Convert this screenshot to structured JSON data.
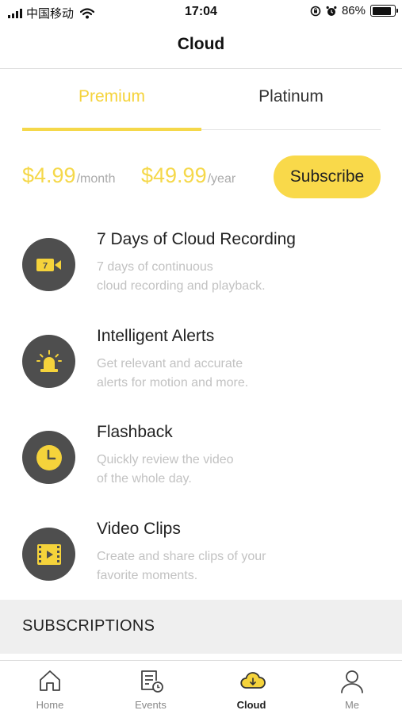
{
  "status_bar": {
    "carrier": "中国移动",
    "time": "17:04",
    "battery": "86%",
    "battery_level": 0.86,
    "icons": [
      "signal-icon",
      "wifi-icon",
      "rotation-lock-icon",
      "alarm-icon",
      "battery-icon"
    ]
  },
  "header": {
    "title": "Cloud"
  },
  "tabs": [
    {
      "label": "Premium",
      "selected": true
    },
    {
      "label": "Platinum",
      "selected": false
    }
  ],
  "pricing": {
    "monthly_amount": "$4.99",
    "monthly_unit": "/month",
    "yearly_amount": "$49.99",
    "yearly_unit": "/year",
    "subscribe_label": "Subscribe"
  },
  "features": [
    {
      "icon": "video-camera-7-icon",
      "title": "7 Days of Cloud Recording",
      "desc_line1": "7 days of continuous",
      "desc_line2": "cloud recording and playback."
    },
    {
      "icon": "alarm-light-icon",
      "title": "Intelligent Alerts",
      "desc_line1": "Get relevant and accurate",
      "desc_line2": "alerts for motion and more."
    },
    {
      "icon": "clock-icon",
      "title": "Flashback",
      "desc_line1": "Quickly review the video",
      "desc_line2": "of the whole day."
    },
    {
      "icon": "film-clip-icon",
      "title": "Video Clips",
      "desc_line1": "Create and share clips of your",
      "desc_line2": "favorite moments."
    }
  ],
  "subscriptions": {
    "heading": "SUBSCRIPTIONS"
  },
  "bottom_nav": [
    {
      "label": "Home",
      "icon": "home-icon",
      "active": false
    },
    {
      "label": "Events",
      "icon": "events-icon",
      "active": false
    },
    {
      "label": "Cloud",
      "icon": "cloud-icon",
      "active": true
    },
    {
      "label": "Me",
      "icon": "person-icon",
      "active": false
    }
  ],
  "colors": {
    "accent": "#f9d94a",
    "icon_circle": "#4e4e4e",
    "muted_text": "#c2c2c2",
    "section_bg": "#efefef"
  }
}
